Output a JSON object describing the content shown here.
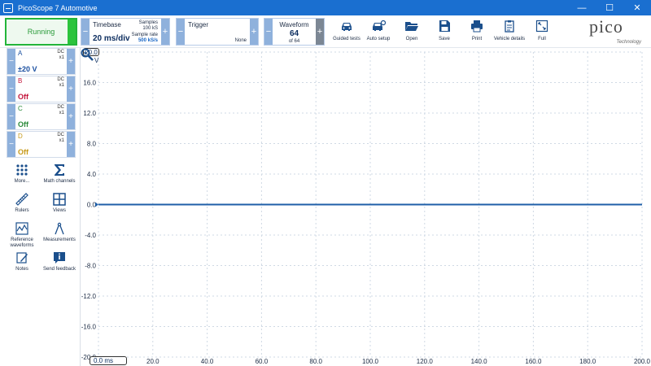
{
  "window": {
    "title": "PicoScope 7 Automotive",
    "controls": [
      "minimize-icon",
      "maximize-icon",
      "close-icon"
    ]
  },
  "toolbar": {
    "run_label": "Running",
    "timebase": {
      "label": "Timebase",
      "value": "20 ms/div",
      "samples_label": "Samples",
      "samples_value": "100 kS",
      "rate_label": "Sample rate",
      "rate_value": "500 kS/s"
    },
    "trigger": {
      "label": "Trigger",
      "mode": "None"
    },
    "waveform": {
      "label": "Waveform",
      "value": "64",
      "of": "of 64"
    },
    "tools": [
      {
        "label": "Guided tests",
        "icon": "car-icon"
      },
      {
        "label": "Auto setup",
        "icon": "car-wrench-icon"
      },
      {
        "label": "Open",
        "icon": "folder-open-icon"
      },
      {
        "label": "Save",
        "icon": "save-icon"
      },
      {
        "label": "Print",
        "icon": "printer-icon"
      },
      {
        "label": "Vehicle details",
        "icon": "clipboard-icon"
      },
      {
        "label": "Full",
        "icon": "fullscreen-icon"
      }
    ],
    "brand": "pico",
    "brand_sub": "Technology"
  },
  "channels": [
    {
      "letter": "A",
      "coupling": "DC",
      "probe": "x1",
      "range": "±20 V",
      "color": "#1a4fa0"
    },
    {
      "letter": "B",
      "coupling": "DC",
      "probe": "x1",
      "range": "Off",
      "color": "#c4153b"
    },
    {
      "letter": "C",
      "coupling": "DC",
      "probe": "x1",
      "range": "Off",
      "color": "#2a8a3a"
    },
    {
      "letter": "D",
      "coupling": "DC",
      "probe": "x1",
      "range": "Off",
      "color": "#c79a1a"
    }
  ],
  "side_buttons": [
    {
      "label": "More...",
      "icon": "grid-dots-icon"
    },
    {
      "label": "Math channels",
      "icon": "sigma-icon"
    },
    {
      "label": "Rulers",
      "icon": "ruler-icon"
    },
    {
      "label": "Views",
      "icon": "views-grid-icon"
    },
    {
      "label": "Reference waveforms",
      "icon": "reference-waveform-icon"
    },
    {
      "label": "Measurements",
      "icon": "measure-compass-icon"
    },
    {
      "label": "Notes",
      "icon": "notes-icon"
    },
    {
      "label": "Send feedback",
      "icon": "info-icon"
    }
  ],
  "plot": {
    "y_scale_top": "20.0",
    "y_unit": "V",
    "y_ticks": [
      "16.0",
      "12.0",
      "8.0",
      "4.0",
      "0.0",
      "-4.0",
      "-8.0",
      "-12.0",
      "-16.0",
      "-20.0"
    ],
    "x_start": "0.0 ms",
    "x_ticks": [
      "20.0",
      "40.0",
      "60.0",
      "80.0",
      "100.0",
      "120.0",
      "140.0",
      "160.0",
      "180.0",
      "200.0"
    ],
    "zoom_icon": "zoom-icon"
  },
  "chart_data": {
    "type": "line",
    "x_unit": "ms",
    "y_unit": "V",
    "xlim": [
      0,
      200
    ],
    "ylim": [
      -20,
      20
    ],
    "grid": true,
    "series": [
      {
        "name": "A",
        "color": "#1f5fa8",
        "x": [
          0,
          200
        ],
        "y": [
          0.0,
          0.0
        ]
      }
    ]
  }
}
